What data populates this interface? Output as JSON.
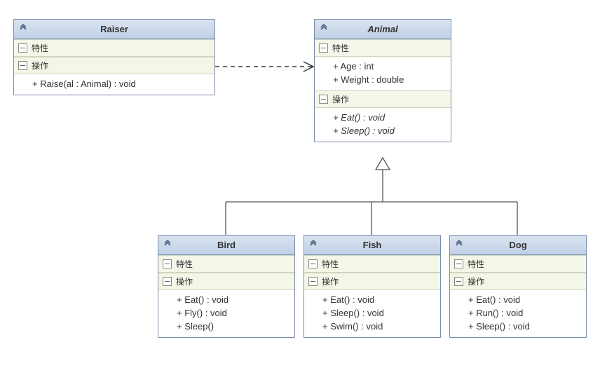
{
  "labels": {
    "attributes": "特性",
    "operations": "操作"
  },
  "classes": {
    "raiser": {
      "name": "Raiser",
      "abstract": false,
      "attributes": [],
      "operations": [
        {
          "text": "+ Raise(al : Animal) : void",
          "abstract": false
        }
      ]
    },
    "animal": {
      "name": "Animal",
      "abstract": true,
      "attributes": [
        {
          "text": "+ Age : int"
        },
        {
          "text": "+ Weight : double"
        }
      ],
      "operations": [
        {
          "text": "+ Eat() : void",
          "abstract": true
        },
        {
          "text": "+ Sleep() : void",
          "abstract": true
        }
      ]
    },
    "bird": {
      "name": "Bird",
      "abstract": false,
      "attributes": [],
      "operations": [
        {
          "text": "+ Eat() : void",
          "abstract": false
        },
        {
          "text": "+ Fly() : void",
          "abstract": false
        },
        {
          "text": "+ Sleep()",
          "abstract": false
        }
      ]
    },
    "fish": {
      "name": "Fish",
      "abstract": false,
      "attributes": [],
      "operations": [
        {
          "text": "+ Eat() : void",
          "abstract": false
        },
        {
          "text": "+ Sleep() : void",
          "abstract": false
        },
        {
          "text": "+ Swim() : void",
          "abstract": false
        }
      ]
    },
    "dog": {
      "name": "Dog",
      "abstract": false,
      "attributes": [],
      "operations": [
        {
          "text": "+ Eat() : void",
          "abstract": false
        },
        {
          "text": "+ Run() : void",
          "abstract": false
        },
        {
          "text": "+ Sleep() : void",
          "abstract": false
        }
      ]
    }
  },
  "relationships": [
    {
      "type": "dependency",
      "from": "raiser",
      "to": "animal"
    },
    {
      "type": "generalization",
      "parent": "animal",
      "children": [
        "bird",
        "fish",
        "dog"
      ]
    }
  ]
}
